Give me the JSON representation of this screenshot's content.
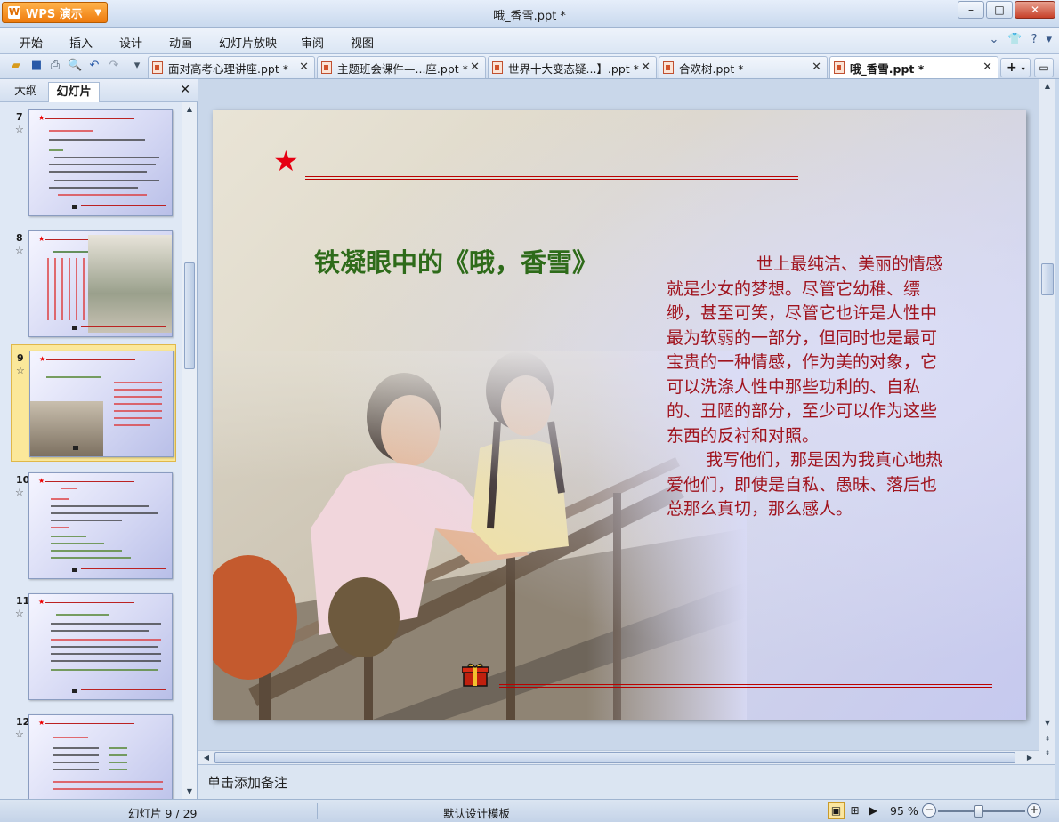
{
  "titlebar": {
    "app_name": "WPS 演示",
    "window_title": "哦_香雪.ppt *",
    "logo_letter": "W"
  },
  "menu": {
    "items": [
      "开始",
      "插入",
      "设计",
      "动画",
      "幻灯片放映",
      "审阅",
      "视图"
    ]
  },
  "tabs": [
    {
      "label": "面对高考心理讲座.ppt *",
      "active": false
    },
    {
      "label": "主题班会课件—...座.ppt *",
      "active": false
    },
    {
      "label": "世界十大变态疑...】.ppt *",
      "active": false
    },
    {
      "label": "合欢树.ppt *",
      "active": false
    },
    {
      "label": "哦_香雪.ppt *",
      "active": true
    }
  ],
  "left_panel": {
    "tab_outline": "大纲",
    "tab_slides": "幻灯片",
    "thumbnails": [
      {
        "number": "7",
        "selected": false
      },
      {
        "number": "8",
        "selected": false
      },
      {
        "number": "9",
        "selected": true
      },
      {
        "number": "10",
        "selected": false
      },
      {
        "number": "11",
        "selected": false
      },
      {
        "number": "12",
        "selected": false
      }
    ]
  },
  "slide": {
    "title": "铁凝眼中的《哦，香雪》",
    "paragraph1": "世上最纯洁、美丽的情感就是少女的梦想。尽管它幼稚、缥缈，甚至可笑，尽管它也许是人性中最为软弱的一部分，但同时也是最可宝贵的一种情感，作为美的对象，它可以洗涤人性中那些功利的、自私的、丑陋的部分，至少可以作为这些东西的反衬和对照。",
    "paragraph2": "我写他们，那是因为我真心地热爱他们，即使是自私、愚昧、落后也总那么真切，那么感人。",
    "colors": {
      "title": "#2e6b1a",
      "body": "#a0141e",
      "star": "#e60012"
    }
  },
  "notes": {
    "placeholder": "单击添加备注"
  },
  "status": {
    "slide_info": "幻灯片 9 / 29",
    "template": "默认设计模板",
    "zoom": "95 %",
    "zoom_value": 95
  }
}
